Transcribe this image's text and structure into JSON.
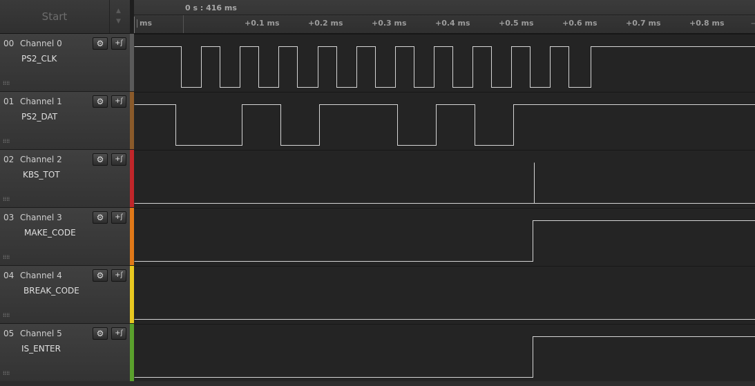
{
  "start_label": "Start",
  "timeline": {
    "origin_label": "0 s : 416 ms",
    "first_tick": "ms",
    "ticks": [
      "+0.1 ms",
      "+0.2 ms",
      "+0.3 ms",
      "+0.4 ms",
      "+0.5 ms",
      "+0.6 ms",
      "+0.7 ms",
      "+0.8 ms"
    ]
  },
  "channels": [
    {
      "num": "00",
      "name": "Channel 0",
      "label": "PS2_CLK",
      "color": "#5a5a5a",
      "edges": [
        [
          0,
          1
        ],
        [
          68,
          0
        ],
        [
          97,
          1
        ],
        [
          124,
          0
        ],
        [
          153,
          1
        ],
        [
          180,
          0
        ],
        [
          209,
          1
        ],
        [
          236,
          0
        ],
        [
          266,
          1
        ],
        [
          293,
          0
        ],
        [
          322,
          1
        ],
        [
          349,
          0
        ],
        [
          378,
          1
        ],
        [
          405,
          0
        ],
        [
          434,
          1
        ],
        [
          461,
          0
        ],
        [
          490,
          1
        ],
        [
          517,
          0
        ],
        [
          546,
          1
        ],
        [
          573,
          0
        ],
        [
          602,
          1
        ],
        [
          629,
          0
        ],
        [
          661,
          1
        ]
      ]
    },
    {
      "num": "01",
      "name": "Channel 1",
      "label": "PS2_DAT",
      "color": "#8a5a2a",
      "edges": [
        [
          0,
          1
        ],
        [
          60,
          0
        ],
        [
          156,
          1
        ],
        [
          212,
          0
        ],
        [
          268,
          1
        ],
        [
          381,
          0
        ],
        [
          437,
          1
        ],
        [
          493,
          0
        ],
        [
          549,
          1
        ]
      ]
    },
    {
      "num": "02",
      "name": "Channel 2",
      "label": "KBS_TOT",
      "color": "#c0262a",
      "edges": [
        [
          0,
          0
        ]
      ],
      "spikes": [
        579
      ]
    },
    {
      "num": "03",
      "name": "Channel 3",
      "label": "MAKE_CODE",
      "color": "#e07818",
      "edges": [
        [
          0,
          0
        ],
        [
          577,
          1
        ]
      ]
    },
    {
      "num": "04",
      "name": "Channel 4",
      "label": "BREAK_CODE",
      "color": "#e8c820",
      "edges": [
        [
          0,
          0
        ]
      ]
    },
    {
      "num": "05",
      "name": "Channel 5",
      "label": "IS_ENTER",
      "color": "#5aa02c",
      "edges": [
        [
          0,
          0
        ],
        [
          577,
          1
        ]
      ]
    }
  ]
}
